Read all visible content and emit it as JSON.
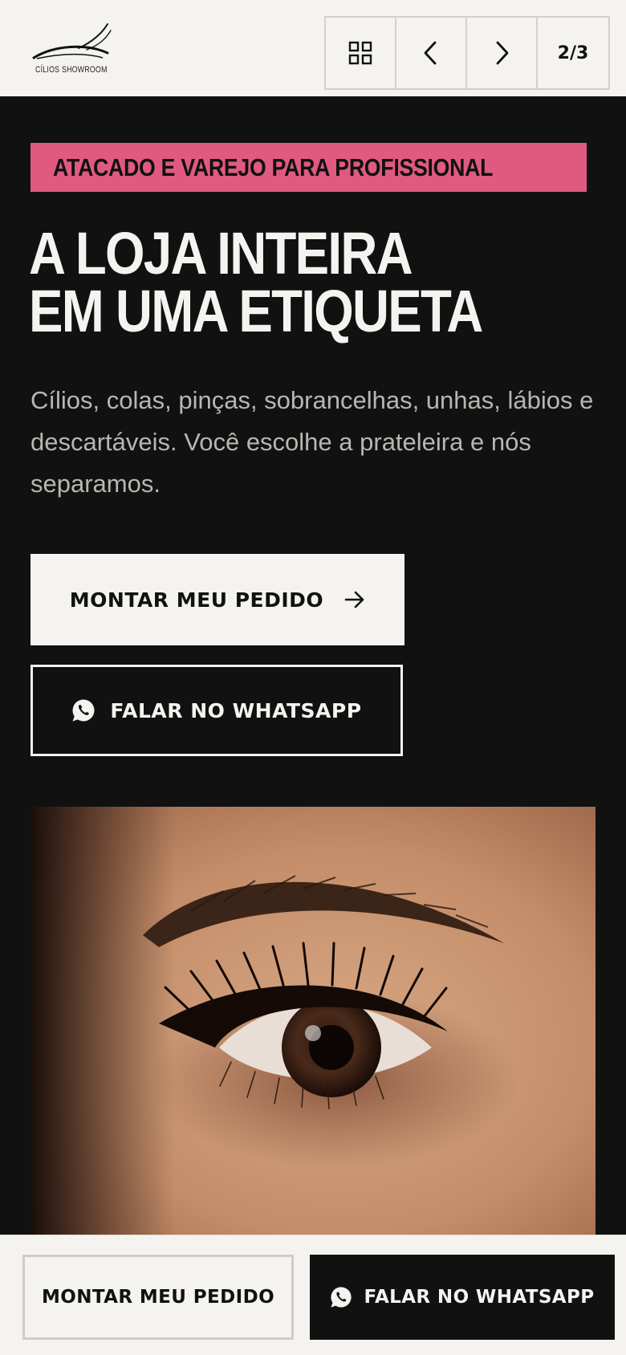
{
  "header": {
    "logo_text": "CÍLIOS SHOWROOM",
    "page_indicator": "2/3",
    "icons": [
      "grid-icon",
      "chevron-left-icon",
      "chevron-right-icon"
    ]
  },
  "hero": {
    "badge": "ATACADO E VAREJO PARA PROFISSIONAL",
    "headline_line1": "A LOJA INTEIRA",
    "headline_line2": "EM UMA ETIQUETA",
    "subtext": "Cílios, colas, pinças, sobrancelhas, unhas, lábios e descartáveis. Você escolhe a prateleira e nós separamos.",
    "primary_button": "MONTAR MEU PEDIDO",
    "whatsapp_button": "FALAR NO WHATSAPP"
  },
  "bottom_bar": {
    "order_button": "MONTAR MEU PEDIDO",
    "whatsapp_button": "FALAR NO WHATSAPP"
  },
  "colors": {
    "background": "#f5f3ef",
    "dark": "#111111",
    "accent_pink": "#e05a80",
    "muted_text": "#b9b6b1",
    "border": "#d3d0cb"
  }
}
